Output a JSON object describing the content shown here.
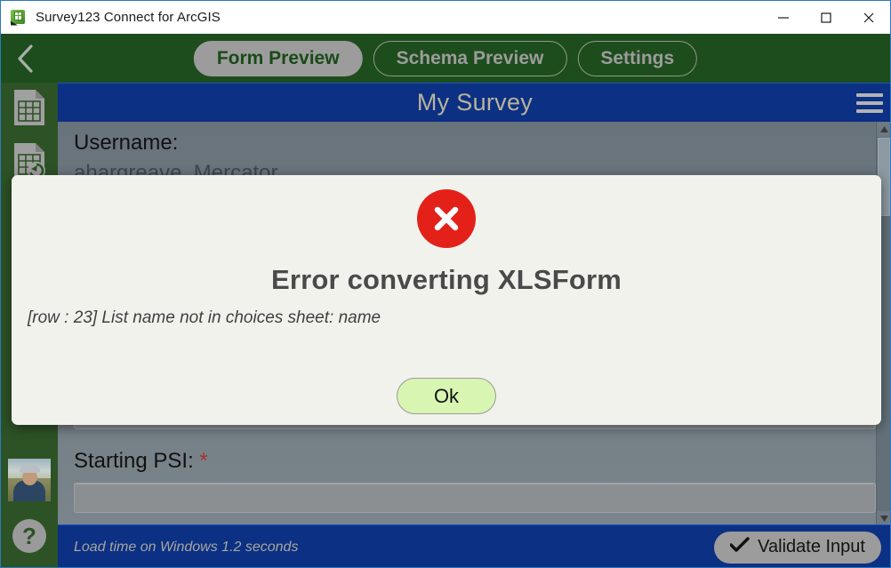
{
  "window": {
    "title": "Survey123 Connect for ArcGIS",
    "app_icon": "survey123-cube-icon",
    "controls": [
      {
        "name": "minimize-button",
        "icon": "minimize-icon"
      },
      {
        "name": "maximize-button",
        "icon": "maximize-icon"
      },
      {
        "name": "close-button",
        "icon": "close-icon"
      }
    ]
  },
  "toolbar": {
    "back_icon": "chevron-left-icon",
    "tabs": [
      {
        "label": "Form Preview",
        "active": true
      },
      {
        "label": "Schema Preview",
        "active": false
      },
      {
        "label": "Settings",
        "active": false
      }
    ]
  },
  "left_rail": {
    "items": [
      {
        "name": "spreadsheet-icon",
        "label": ""
      },
      {
        "name": "spreadsheet-refresh-icon",
        "label": ""
      },
      {
        "name": "avatar",
        "label": ""
      },
      {
        "name": "help-icon",
        "label": "?"
      }
    ]
  },
  "survey": {
    "title": "My Survey",
    "menu_icon": "hamburger-icon",
    "fields": [
      {
        "label": "Username:",
        "required": false,
        "value": "ahargreave_Mercator"
      },
      {
        "label": "Starting PSI:",
        "required": true,
        "value": ""
      }
    ]
  },
  "status_bar": {
    "load_time": "Load time on Windows 1.2 seconds",
    "validate_label": "Validate Input",
    "validate_icon": "checkmark-icon"
  },
  "dialog": {
    "icon": "error-circle-x-icon",
    "title": "Error converting XLSForm",
    "message": "[row : 23] List name not in choices sheet: name",
    "ok_label": "Ok"
  },
  "colors": {
    "toolbar_green": "#1d4d1c",
    "rail_green": "#2d5226",
    "survey_blue": "#0c3084",
    "error_red": "#e32119",
    "ok_green": "#d8f5b2",
    "required_red": "#a8342c"
  }
}
